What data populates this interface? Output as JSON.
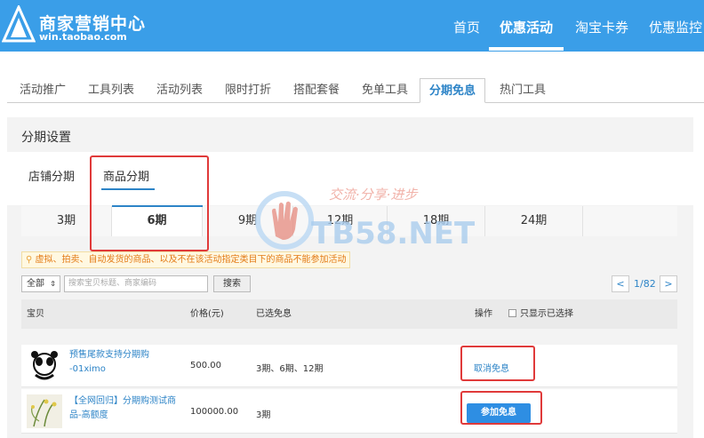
{
  "header": {
    "brand": "商家营销中心",
    "url": "win.taobao.com",
    "nav": [
      "首页",
      "优惠活动",
      "淘宝卡券",
      "优惠监控"
    ],
    "active_nav": "优惠活动"
  },
  "tabs": {
    "items": [
      "活动推广",
      "工具列表",
      "活动列表",
      "限时打折",
      "搭配套餐",
      "免单工具",
      "分期免息",
      "热门工具"
    ],
    "active": "分期免息"
  },
  "panel": {
    "title": "分期设置",
    "subtabs": [
      "店铺分期",
      "商品分期"
    ],
    "active_subtab": "商品分期",
    "periods": [
      "3期",
      "6期",
      "9期",
      "12期",
      "18期",
      "24期"
    ],
    "active_period": "6期",
    "notice": "虚拟、拍卖、自动发货的商品、以及不在该活动指定类目下的商品不能参加活动"
  },
  "search": {
    "select_value": "全部",
    "placeholder": "搜索宝贝标题、商家编码",
    "button": "搜索"
  },
  "pager": {
    "prev": "<",
    "text": "1/82",
    "next": ">"
  },
  "table": {
    "headers": {
      "item": "宝贝",
      "price": "价格(元)",
      "chosen": "已选免息",
      "action": "操作",
      "only_selected": "只显示已选择"
    },
    "rows": [
      {
        "name": "预售尾款支持分期购 -01ximo",
        "price": "500.00",
        "periods": "3期、6期、12期",
        "action": "取消免息"
      },
      {
        "name": "【全网回归】分期购测试商品-高额度",
        "price": "100000.00",
        "periods": "3期",
        "action": "参加免息"
      }
    ]
  },
  "watermark": {
    "slogan": "交流·分享·进步",
    "site": "TB58.NET"
  },
  "colors": {
    "header_bg": "#3a9ee8",
    "link": "#2d84c7",
    "highlight_box": "#e03a3a",
    "notice_text": "#e37b17",
    "join_button": "#2e8ee3"
  }
}
